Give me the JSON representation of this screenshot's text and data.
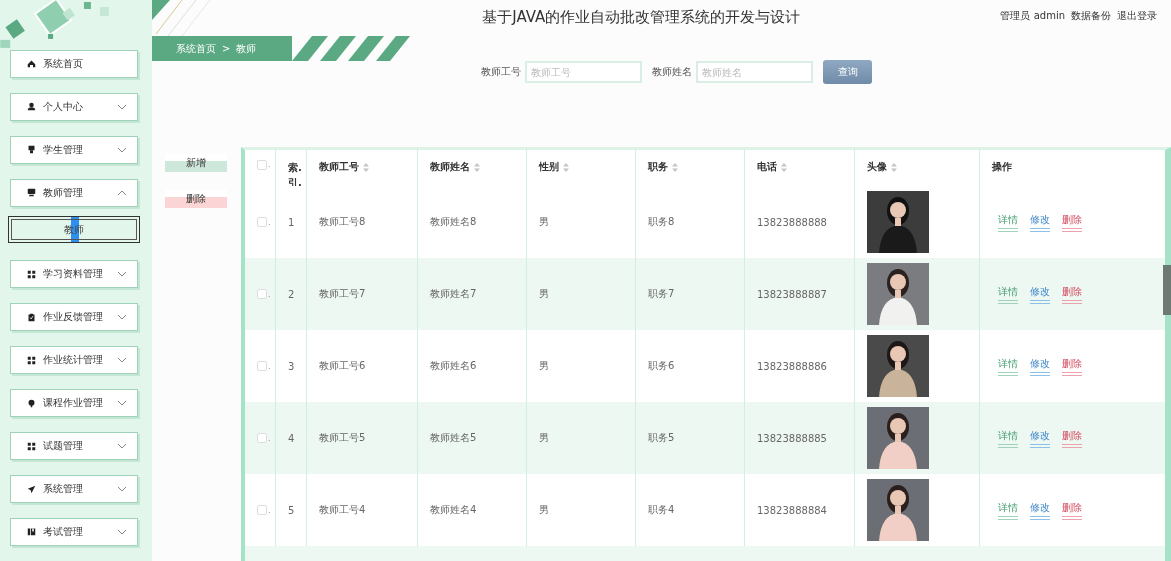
{
  "header": {
    "title": "基于JAVA的作业自动批改管理系统的开发与设计",
    "links": [
      "管理员 admin",
      "数据备份",
      "退出登录"
    ]
  },
  "sidebar": {
    "items": [
      {
        "label": "系统首页",
        "kind": "link"
      },
      {
        "label": "个人中心",
        "kind": "group",
        "expanded": false
      },
      {
        "label": "学生管理",
        "kind": "group",
        "expanded": false
      },
      {
        "label": "教师管理",
        "kind": "group",
        "expanded": true,
        "children": [
          {
            "label": "教师",
            "selected": true
          }
        ]
      },
      {
        "label": "学习资料管理",
        "kind": "group",
        "expanded": false
      },
      {
        "label": "作业反馈管理",
        "kind": "group",
        "expanded": false
      },
      {
        "label": "作业统计管理",
        "kind": "group",
        "expanded": false
      },
      {
        "label": "课程作业管理",
        "kind": "group",
        "expanded": false
      },
      {
        "label": "试题管理",
        "kind": "group",
        "expanded": false
      },
      {
        "label": "系统管理",
        "kind": "group",
        "expanded": false
      },
      {
        "label": "考试管理",
        "kind": "group",
        "expanded": false
      }
    ]
  },
  "breadcrumb": [
    "系统首页",
    ">",
    "教师"
  ],
  "search": {
    "fields": [
      {
        "label": "教师工号",
        "placeholder": "教师工号"
      },
      {
        "label": "教师姓名",
        "placeholder": "教师姓名"
      }
    ],
    "button": "查询"
  },
  "actions": [
    {
      "label": "新增",
      "kind": "add"
    },
    {
      "label": "删除",
      "kind": "delete"
    }
  ],
  "table": {
    "checkbox_mark": ".",
    "header_checked": false,
    "columns": [
      {
        "label": "索.引.",
        "sortable": false
      },
      {
        "label": "教师工号",
        "sortable": true
      },
      {
        "label": "教师姓名",
        "sortable": true
      },
      {
        "label": "性别",
        "sortable": true
      },
      {
        "label": "职务",
        "sortable": true
      },
      {
        "label": "电话",
        "sortable": true
      },
      {
        "label": "头像",
        "sortable": true
      },
      {
        "label": "操作",
        "sortable": false
      }
    ],
    "rows": [
      {
        "checked": false,
        "cells": [
          "1",
          "教师工号8",
          "教师姓名8",
          "男",
          "职务8",
          "13823888888"
        ],
        "ops": [
          {
            "label": "详情",
            "kind": "detail"
          },
          {
            "label": "修改",
            "kind": "edit"
          },
          {
            "label": "删除",
            "kind": "delete"
          }
        ]
      },
      {
        "checked": false,
        "cells": [
          "2",
          "教师工号7",
          "教师姓名7",
          "男",
          "职务7",
          "13823888887"
        ],
        "ops": [
          {
            "label": "详情",
            "kind": "detail"
          },
          {
            "label": "修改",
            "kind": "edit"
          },
          {
            "label": "删除",
            "kind": "delete"
          }
        ]
      },
      {
        "checked": false,
        "cells": [
          "3",
          "教师工号6",
          "教师姓名6",
          "男",
          "职务6",
          "13823888886"
        ],
        "ops": [
          {
            "label": "详情",
            "kind": "detail"
          },
          {
            "label": "修改",
            "kind": "edit"
          },
          {
            "label": "删除",
            "kind": "delete"
          }
        ]
      },
      {
        "checked": false,
        "cells": [
          "4",
          "教师工号5",
          "教师姓名5",
          "男",
          "职务5",
          "13823888885"
        ],
        "ops": [
          {
            "label": "详情",
            "kind": "detail"
          },
          {
            "label": "修改",
            "kind": "edit"
          },
          {
            "label": "删除",
            "kind": "delete"
          }
        ]
      },
      {
        "checked": false,
        "cells": [
          "5",
          "教师工号4",
          "教师姓名4",
          "男",
          "职务4",
          "13823888884"
        ],
        "ops": [
          {
            "label": "详情",
            "kind": "detail"
          },
          {
            "label": "修改",
            "kind": "edit"
          },
          {
            "label": "删除",
            "kind": "delete"
          }
        ]
      }
    ]
  }
}
